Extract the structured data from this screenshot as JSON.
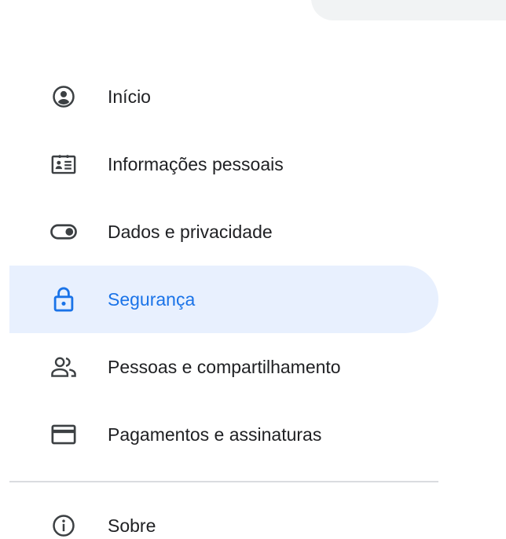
{
  "nav": {
    "items": [
      {
        "label": "Início",
        "icon": "account-circle-icon"
      },
      {
        "label": "Informações pessoais",
        "icon": "id-card-icon"
      },
      {
        "label": "Dados e privacidade",
        "icon": "toggle-icon"
      },
      {
        "label": "Segurança",
        "icon": "lock-icon",
        "active": true
      },
      {
        "label": "Pessoas e compartilhamento",
        "icon": "people-icon"
      },
      {
        "label": "Pagamentos e assinaturas",
        "icon": "credit-card-icon"
      }
    ],
    "about": {
      "label": "Sobre",
      "icon": "info-icon"
    }
  },
  "colors": {
    "active_bg": "#e8f0fe",
    "active_fg": "#1a73e8",
    "text": "#202124",
    "icon": "#3c4043",
    "divider": "#dadce0"
  }
}
